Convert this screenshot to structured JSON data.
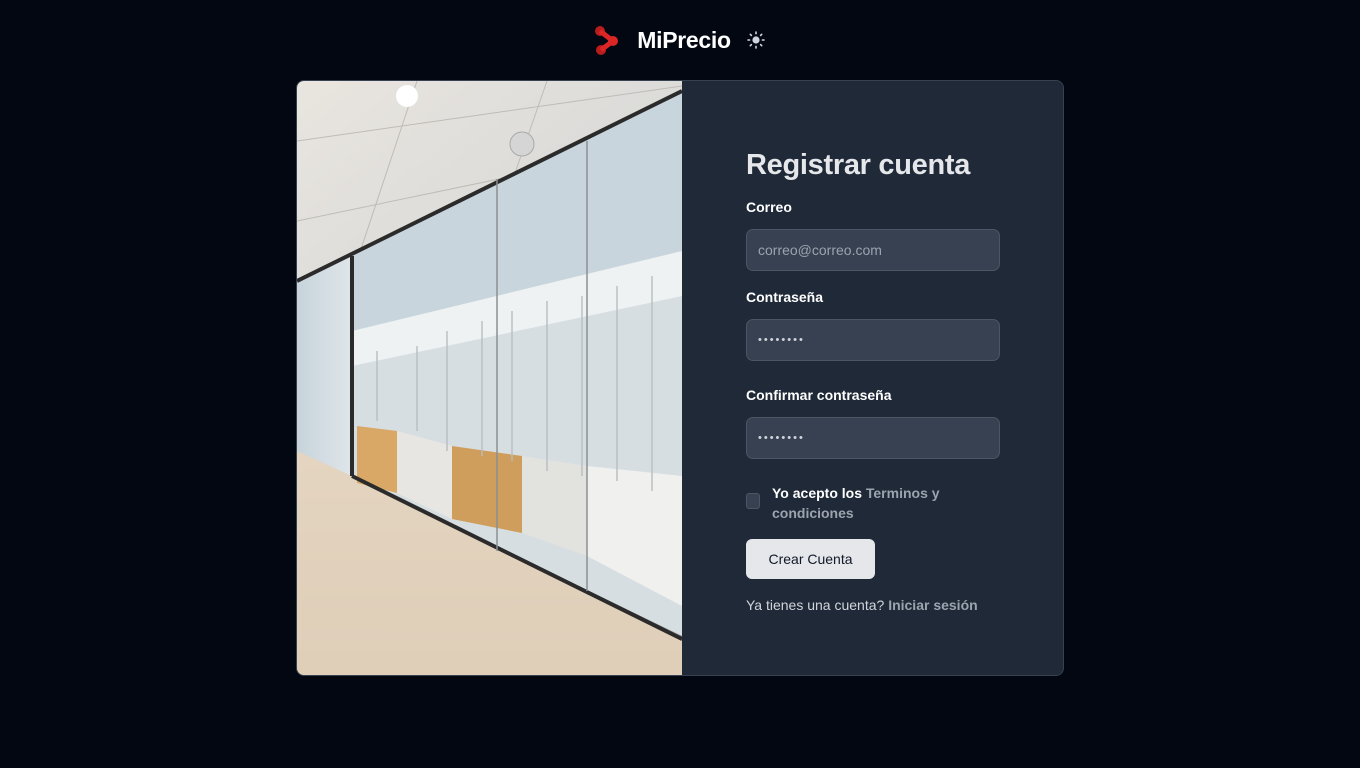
{
  "brand": {
    "name": "MiPrecio",
    "logo_icon": "share-nodes-icon",
    "logo_color": "#dc2626",
    "theme_icon": "sun-icon"
  },
  "hero": {
    "image_icon": "office-hallway-photo"
  },
  "form": {
    "title": "Registrar cuenta",
    "email_label": "Correo",
    "email_placeholder": "correo@correo.com",
    "password_label": "Contraseña",
    "password_value": "••••••••",
    "confirm_label": "Confirmar contraseña",
    "confirm_value": "••••••••",
    "terms_prefix": "Yo acepto los",
    "terms_link": "Terminos y condiciones",
    "submit_label": "Crear Cuenta",
    "login_prompt": "Ya tienes una cuenta?",
    "login_link": "Iniciar sesión"
  },
  "colors": {
    "background": "#030712",
    "card": "#1f2937",
    "input": "#374151",
    "accent": "#dc2626"
  }
}
